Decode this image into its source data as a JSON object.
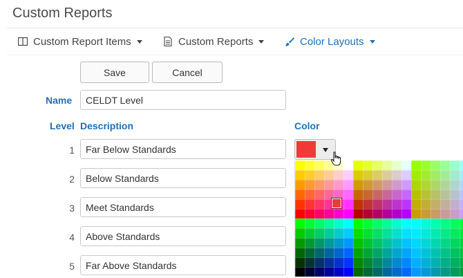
{
  "page": {
    "title": "Custom Reports"
  },
  "nav": [
    {
      "label": "Custom Report Items",
      "icon": "columns-icon"
    },
    {
      "label": "Custom Reports",
      "icon": "document-icon"
    },
    {
      "label": "Color Layouts",
      "icon": "paintbrush-icon",
      "active": true
    }
  ],
  "actions": {
    "save_label": "Save",
    "cancel_label": "Cancel"
  },
  "form": {
    "name_label": "Name",
    "name_value": "CELDT Level",
    "level_header": "Level",
    "description_header": "Description",
    "color_header": "Color"
  },
  "levels": [
    {
      "number": "1",
      "description": "Far Below Standards"
    },
    {
      "number": "2",
      "description": "Below Standards"
    },
    {
      "number": "3",
      "description": "Meet Standards"
    },
    {
      "number": "4",
      "description": "Above Standards"
    },
    {
      "number": "5",
      "description": "Far Above Standards"
    }
  ],
  "color_picker": {
    "selected_color": "#f03a3a",
    "open": true
  },
  "colors": {
    "accent": "#1f6fb5"
  }
}
